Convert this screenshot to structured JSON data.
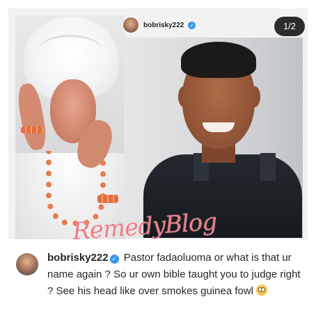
{
  "post": {
    "username": "bobrisky222",
    "page_counter": "1/2",
    "watermark": "RemedyBlog"
  },
  "caption": {
    "username": "bobrisky222",
    "text": "Pastor fadaoluoma or what is that ur name again ? So ur own bible taught you to judge right ? See his head like over smokes guinea fowl",
    "emoji": "flushed-face-emoji"
  },
  "icons": {
    "verified": "verified-badge-icon"
  },
  "colors": {
    "verified_blue": "#3897f0",
    "watermark_pink": "#f07c86",
    "counter_bg": "#2c2c2c"
  }
}
